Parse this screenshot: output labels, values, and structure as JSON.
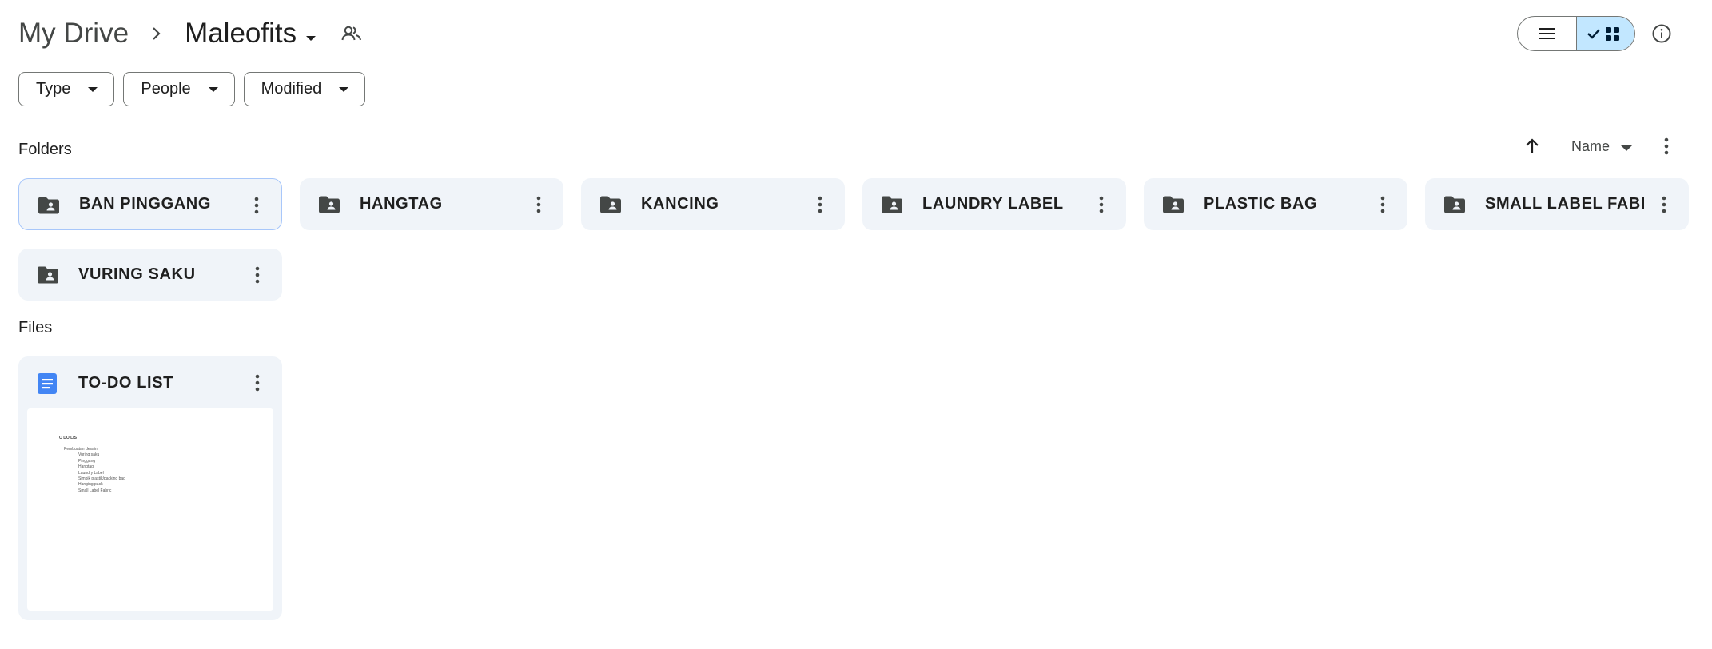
{
  "breadcrumb": {
    "root": "My Drive",
    "current": "Maleofits"
  },
  "filters": [
    "Type",
    "People",
    "Modified"
  ],
  "sections": {
    "folders_label": "Folders",
    "files_label": "Files"
  },
  "sort": {
    "label": "Name",
    "direction": "ascending"
  },
  "view": {
    "mode": "grid"
  },
  "folders": [
    {
      "name": "BAN PINGGANG",
      "selected": true
    },
    {
      "name": "HANGTAG"
    },
    {
      "name": "KANCING"
    },
    {
      "name": "LAUNDRY LABEL"
    },
    {
      "name": "PLASTIC BAG"
    },
    {
      "name": "SMALL LABEL FABRIC"
    },
    {
      "name": "VURING SAKU"
    }
  ],
  "files": [
    {
      "name": "TO-DO LIST",
      "type": "google-docs-icon",
      "preview": {
        "title": "TO DO LIST",
        "lines": [
          "Pembuatan desain:",
          "Vuring saku",
          "Pinggang",
          "Hangtag",
          "Laundry Label",
          "Simpik plastik/packing bag",
          "Hanging pack",
          "Small Label Fabric"
        ]
      }
    }
  ],
  "colors": {
    "card_bg": "#f0f4f9",
    "toggle_active": "#c2e7ff",
    "doc_blue": "#4285f4",
    "selected_border": "#a8c7fa"
  }
}
